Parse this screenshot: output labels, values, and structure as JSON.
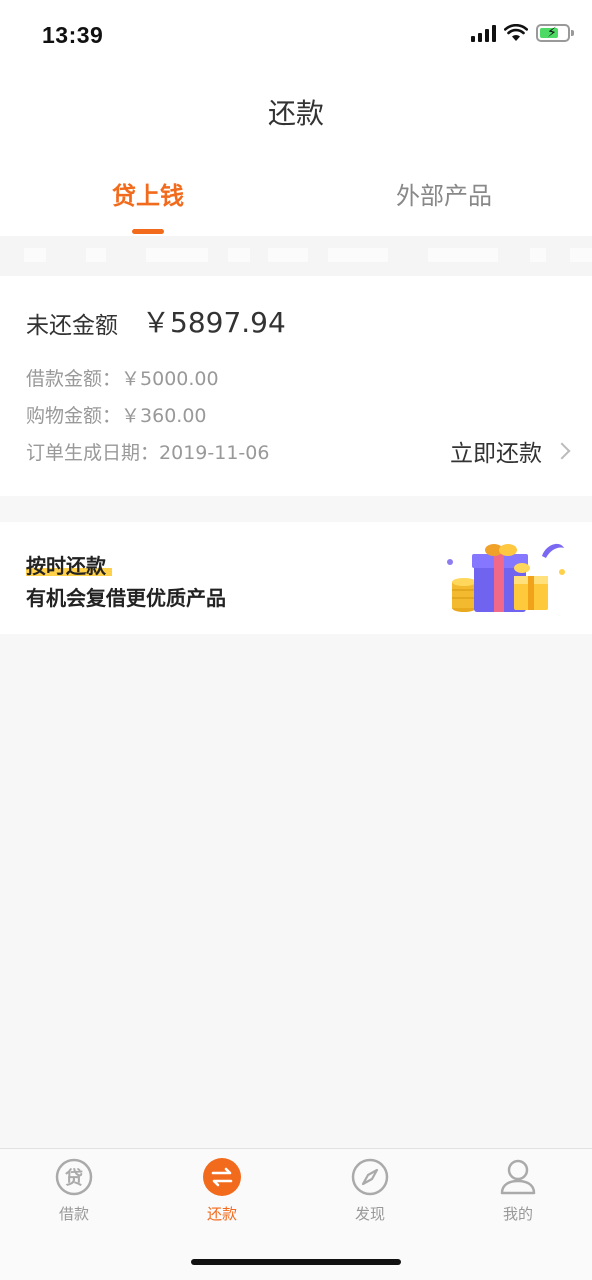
{
  "status": {
    "time": "13:39"
  },
  "header": {
    "title": "还款"
  },
  "tabs": [
    {
      "label": "贷上钱",
      "active": true
    },
    {
      "label": "外部产品",
      "active": false
    }
  ],
  "bill": {
    "unpaid_label": "未还金额",
    "unpaid_amount": "￥5897.94",
    "loan_label": "借款金额：",
    "loan_amount": "￥5000.00",
    "shopping_label": "购物金额：",
    "shopping_amount": "￥360.00",
    "order_date_label": "订单生成日期：",
    "order_date": "2019-11-06",
    "repay_button": "立即还款"
  },
  "promo": {
    "title": "按时还款",
    "subtitle": "有机会复借更优质产品"
  },
  "tabbar": [
    {
      "label": "借款",
      "icon": "loan-icon",
      "active": false
    },
    {
      "label": "还款",
      "icon": "repay-icon",
      "active": true
    },
    {
      "label": "发现",
      "icon": "compass-icon",
      "active": false
    },
    {
      "label": "我的",
      "icon": "user-icon",
      "active": false
    }
  ],
  "colors": {
    "accent": "#f26b1d",
    "highlight": "#ffd04a",
    "inactive": "#999999"
  }
}
